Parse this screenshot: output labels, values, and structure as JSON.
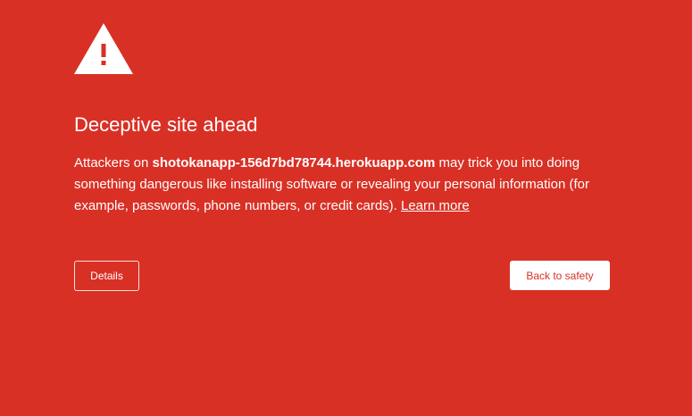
{
  "theme": {
    "background_color": "#d93025",
    "text_color": "#ffffff",
    "icon": "warning-triangle-icon"
  },
  "interstitial": {
    "title": "Deceptive site ahead",
    "message_prefix": "Attackers on ",
    "host": "shotokanapp-156d7bd78744.herokuapp.com",
    "message_suffix": " may trick you into doing something dangerous like installing software or revealing your personal information (for example, passwords, phone numbers, or credit cards). ",
    "learn_more_label": "Learn more"
  },
  "buttons": {
    "details_label": "Details",
    "back_to_safety_label": "Back to safety"
  }
}
